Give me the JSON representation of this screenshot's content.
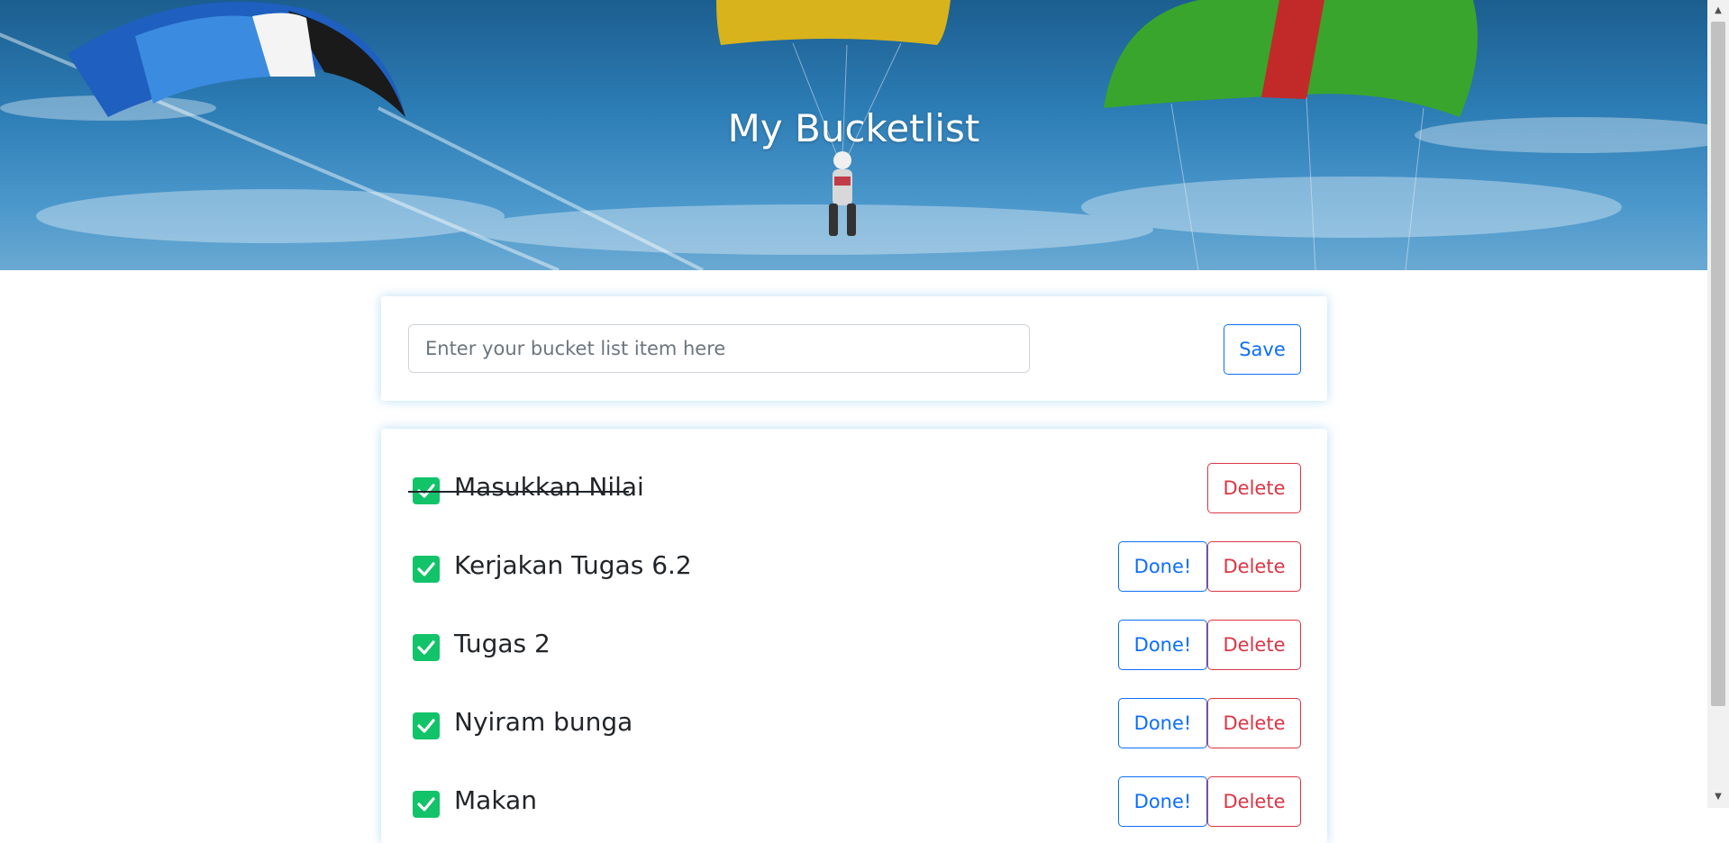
{
  "header": {
    "title": "My Bucketlist"
  },
  "form": {
    "placeholder": "Enter your bucket list item here",
    "value": "",
    "save_label": "Save"
  },
  "items": [
    {
      "text": "Masukkan Nilai",
      "checked": true,
      "done": true,
      "delete_label": "Delete"
    },
    {
      "text": "Kerjakan Tugas 6.2",
      "checked": true,
      "done": false,
      "done_label": "Done!",
      "delete_label": "Delete"
    },
    {
      "text": "Tugas 2",
      "checked": true,
      "done": false,
      "done_label": "Done!",
      "delete_label": "Delete"
    },
    {
      "text": "Nyiram bunga",
      "checked": true,
      "done": false,
      "done_label": "Done!",
      "delete_label": "Delete"
    },
    {
      "text": "Makan",
      "checked": true,
      "done": false,
      "done_label": "Done!",
      "delete_label": "Delete"
    }
  ],
  "colors": {
    "primary": "#0d6efd",
    "danger": "#dc3545",
    "checkbox": "#12c36a",
    "sky": "#2c7cb5"
  },
  "icons": {
    "checkbox": "check-icon"
  }
}
